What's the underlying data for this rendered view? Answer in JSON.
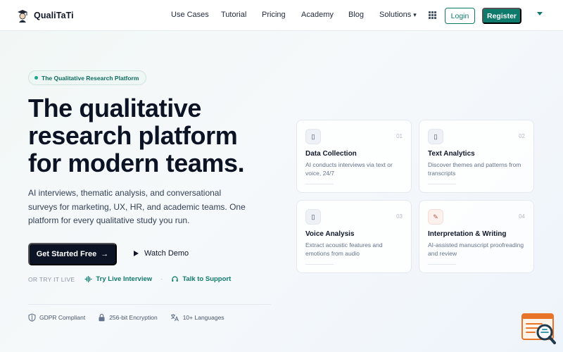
{
  "brand": {
    "name": "QualiTaTi"
  },
  "nav": {
    "links": [
      "Use Cases",
      "Tutorial",
      "Pricing",
      "Academy",
      "Blog"
    ],
    "solutions_label": "Solutions",
    "solutions_caret": "▾",
    "login_label": "Login",
    "register_label": "Register"
  },
  "hero": {
    "pill_label": "The Qualitative Research Platform",
    "title_lines": [
      "The qualitative",
      "research platform",
      "for modern teams."
    ],
    "subtitle": "AI interviews, thematic analysis, and conversational surveys for marketing, UX, HR, and academic teams. One platform for every qualitative study you run.",
    "cta_primary": "Get Started Free",
    "cta_arrow": "→",
    "cta_secondary": "Watch Demo",
    "try_label": "OR TRY IT LIVE",
    "try_live": "Try Live Interview",
    "separator": "·",
    "talk_support": "Talk to Support"
  },
  "trust": [
    {
      "label": "GDPR Compliant",
      "icon": "shield-icon"
    },
    {
      "label": "256-bit Encryption",
      "icon": "lock-icon"
    },
    {
      "label": "10+ Languages",
      "icon": "translate-icon"
    }
  ],
  "cards": [
    {
      "num": "01",
      "title": "Data Collection",
      "desc": "AI conducts interviews via text or voice, 24/7",
      "icon_glyph": "▯",
      "icon": "placeholder-icon"
    },
    {
      "num": "02",
      "title": "Text Analytics",
      "desc": "Discover themes and patterns from transcripts",
      "icon_glyph": "▯",
      "icon": "placeholder-icon"
    },
    {
      "num": "03",
      "title": "Voice Analysis",
      "desc": "Extract acoustic features and emotions from audio",
      "icon_glyph": "▯",
      "icon": "placeholder-icon"
    },
    {
      "num": "04",
      "title": "Interpretation & Writing",
      "desc": "AI-assisted manuscript proofreading and review",
      "icon_glyph": "✎",
      "icon": "pen-icon"
    }
  ],
  "colors": {
    "accent": "#0e7a6c",
    "dark": "#0b1324",
    "widget": "#e8742a"
  }
}
